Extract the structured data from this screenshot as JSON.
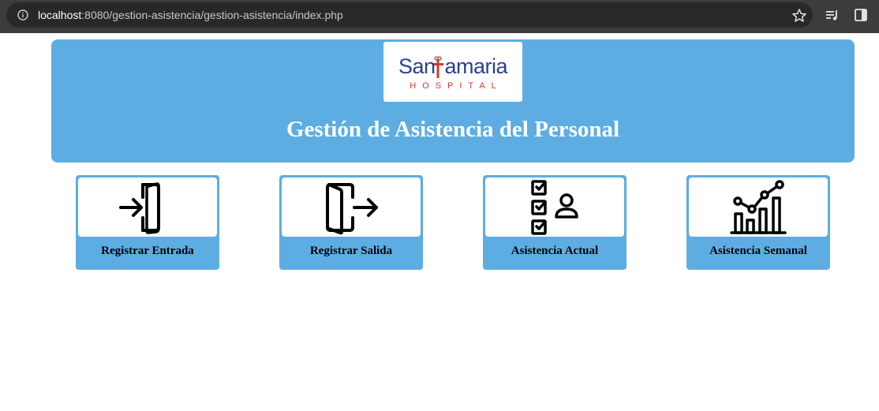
{
  "browser": {
    "url_host": "localhost",
    "url_rest": ":8080/gestion-asistencia/gestion-asistencia/index.php"
  },
  "header": {
    "logo_main_left": "San",
    "logo_main_right": "amaria",
    "logo_sub": "HOSPITAL",
    "title": "Gestión de Asistencia del Personal"
  },
  "cards": [
    {
      "label": "Registrar Entrada",
      "icon": "enter-door-icon"
    },
    {
      "label": "Registrar Salida",
      "icon": "exit-door-icon"
    },
    {
      "label": "Asistencia Actual",
      "icon": "checklist-person-icon"
    },
    {
      "label": "Asistencia Semanal",
      "icon": "bar-chart-trend-icon"
    }
  ],
  "colors": {
    "header_bg": "#5dade2",
    "logo_blue": "#2b3f93",
    "logo_red": "#d33a2c"
  }
}
